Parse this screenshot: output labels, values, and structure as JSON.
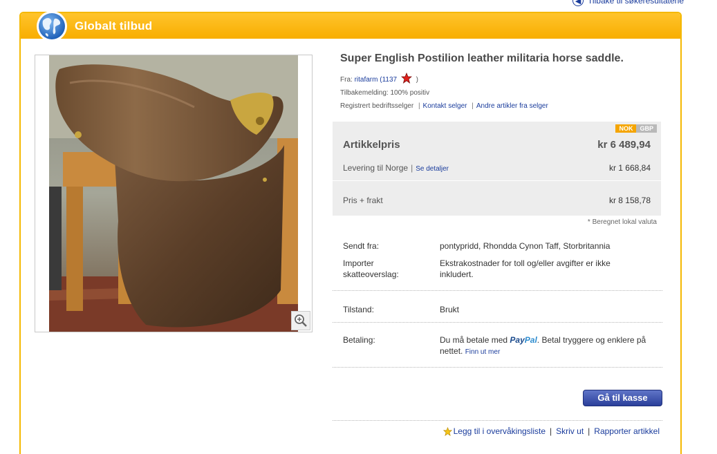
{
  "nav": {
    "back_label": "Tilbake til søkeresultatene"
  },
  "panel": {
    "title": "Globalt tilbud"
  },
  "item": {
    "title": "Super English Postilion leather militaria horse saddle.",
    "seller_prefix": "Fra:",
    "seller_name": "ritafarm",
    "feedback_open": "(",
    "feedback_score": "1137",
    "feedback_close": ")",
    "feedback_label": "Tilbakemelding: 100% positiv",
    "seller_type": "Registrert bedriftsselger",
    "contact_link": "Kontakt selger",
    "other_items_link": "Andre artikler fra selger"
  },
  "price": {
    "currency_tabs": [
      "NOK",
      "GBP"
    ],
    "item_label": "Artikkelpris",
    "item_value": "kr 6 489,94",
    "shipping_label": "Levering til Norge",
    "shipping_details_link": "Se detaljer",
    "shipping_value": "kr 1 668,84",
    "total_label": "Pris + frakt",
    "total_value": "kr 8 158,78",
    "note": "* Beregnet lokal valuta"
  },
  "details": {
    "sent_from_label": "Sendt fra:",
    "sent_from_value": "pontypridd, Rhondda Cynon Taff, Storbritannia",
    "import_label": "Importer skatteoverslag:",
    "import_value": "Ekstrakostnader for toll og/eller avgifter er ikke inkludert.",
    "condition_label": "Tilstand:",
    "condition_value": "Brukt",
    "payment_label": "Betaling:",
    "payment_prefix": "Du må betale med",
    "payment_pay": "Pay",
    "payment_pal": "Pal",
    "payment_suffix": ". Betal tryggere og enklere på nettet.",
    "payment_link": "Finn ut mer"
  },
  "actions": {
    "checkout_label": "Gå til kasse",
    "watchlist_label": "Legg til i overvåkingsliste",
    "print_label": "Skriv ut",
    "report_label": "Rapporter artikkel"
  },
  "colors": {
    "header": "#f8b000",
    "link": "#1a3c9c",
    "button": "#2a3f9a",
    "nok_tab": "#f5a500"
  },
  "icons": [
    "globe-icon",
    "zoom-icon",
    "star-icon",
    "back-arrow-icon",
    "watchlist-star-icon"
  ]
}
